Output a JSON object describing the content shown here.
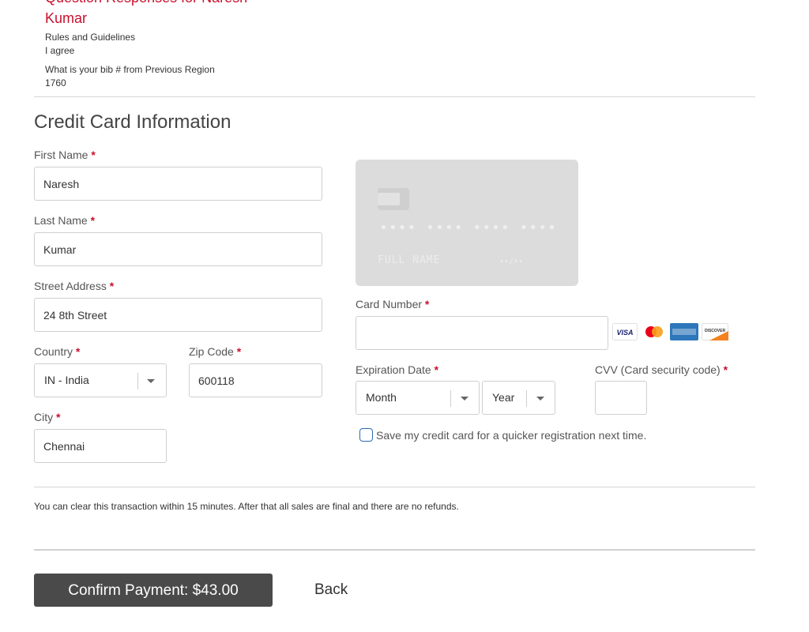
{
  "questions": {
    "title": "Question Responses for Naresh Kumar",
    "items": [
      {
        "question": "Rules and Guidelines",
        "answer": "I agree"
      },
      {
        "question": "What is your bib # from Previous Region",
        "answer": "1760"
      }
    ]
  },
  "credit_card": {
    "title": "Credit Card Information",
    "required_mark": "*",
    "fields": {
      "first_name": {
        "label": "First Name",
        "value": "Naresh"
      },
      "last_name": {
        "label": "Last Name",
        "value": "Kumar"
      },
      "street": {
        "label": "Street Address",
        "value": "24 8th Street"
      },
      "country": {
        "label": "Country",
        "value": "IN - India"
      },
      "zip": {
        "label": "Zip Code",
        "value": "600118"
      },
      "city": {
        "label": "City",
        "value": "Chennai"
      },
      "card_number": {
        "label": "Card Number",
        "value": ""
      },
      "expiration": {
        "label": "Expiration Date",
        "month": "Month",
        "year": "Year"
      },
      "cvv": {
        "label": "CVV (Card security code)",
        "value": ""
      }
    },
    "preview": {
      "dots": "•••• •••• •••• ••••",
      "name": "FULL NAME",
      "expiry": "••/••"
    },
    "brands": [
      "VISA",
      "MASTERCARD",
      "AMERICAN EXPRESS",
      "DISCOVER"
    ],
    "save_card_label": "Save my credit card for a quicker registration next time.",
    "save_card_checked": false
  },
  "notice": "You can clear this transaction within 15 minutes. After that all sales are final and there are no refunds.",
  "actions": {
    "confirm": "Confirm Payment: $43.00",
    "back": "Back"
  },
  "colors": {
    "accent": "#c8102e",
    "button": "#4a4a4a",
    "checkbox": "#2a6bb3"
  }
}
